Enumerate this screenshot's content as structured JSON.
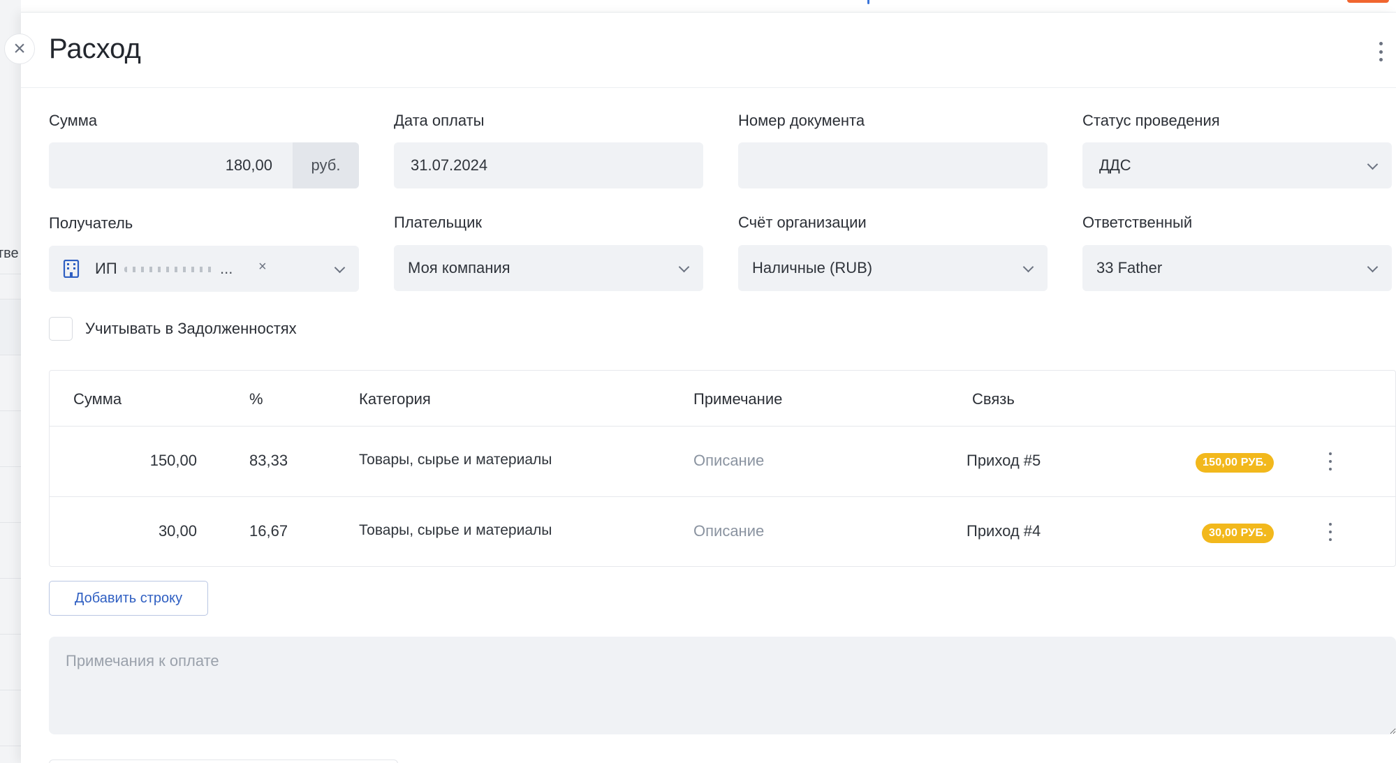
{
  "background": {
    "cut_text": "тве"
  },
  "header": {
    "title": "Расход",
    "close_icon": "×"
  },
  "form": {
    "sum": {
      "label": "Сумма",
      "value": "180,00",
      "unit": "руб."
    },
    "payment_date": {
      "label": "Дата оплаты",
      "value": "31.07.2024"
    },
    "document_number": {
      "label": "Номер документа",
      "value": ""
    },
    "status": {
      "label": "Статус проведения",
      "value": "ДДС"
    },
    "recipient": {
      "label": "Получатель",
      "value": "ИП",
      "ellipsis": "...",
      "clear": "×"
    },
    "payer": {
      "label": "Плательщик",
      "value": "Моя компания"
    },
    "account": {
      "label": "Счёт организации",
      "value": "Наличные (RUB)"
    },
    "responsible": {
      "label": "Ответственный",
      "value": "33 Father"
    },
    "debts_checkbox": {
      "label": "Учитывать в Задолженностях",
      "checked": false
    }
  },
  "table": {
    "headers": {
      "sum": "Сумма",
      "percent": "%",
      "category": "Категория",
      "note": "Примечание",
      "link": "Связь"
    },
    "rows": [
      {
        "sum": "150,00",
        "percent": "83,33",
        "category": "Товары, сырье и материалы",
        "note": "Описание",
        "link": "Приход #5",
        "badge": "150,00 РУБ."
      },
      {
        "sum": "30,00",
        "percent": "16,67",
        "category": "Товары, сырье и материалы",
        "note": "Описание",
        "link": "Приход #4",
        "badge": "30,00 РУБ."
      }
    ]
  },
  "actions": {
    "add_row": "Добавить строку"
  },
  "notes": {
    "placeholder": "Примечания к оплате"
  },
  "colors": {
    "badge": "#f2b81c",
    "accent_link": "#2f5fc2",
    "field_bg": "#f0f2f5",
    "top_accent": "#f0652f"
  },
  "icons": {
    "close": "close-icon",
    "more": "more-vertical-icon",
    "building": "building-icon",
    "chevron": "chevron-down-icon"
  }
}
